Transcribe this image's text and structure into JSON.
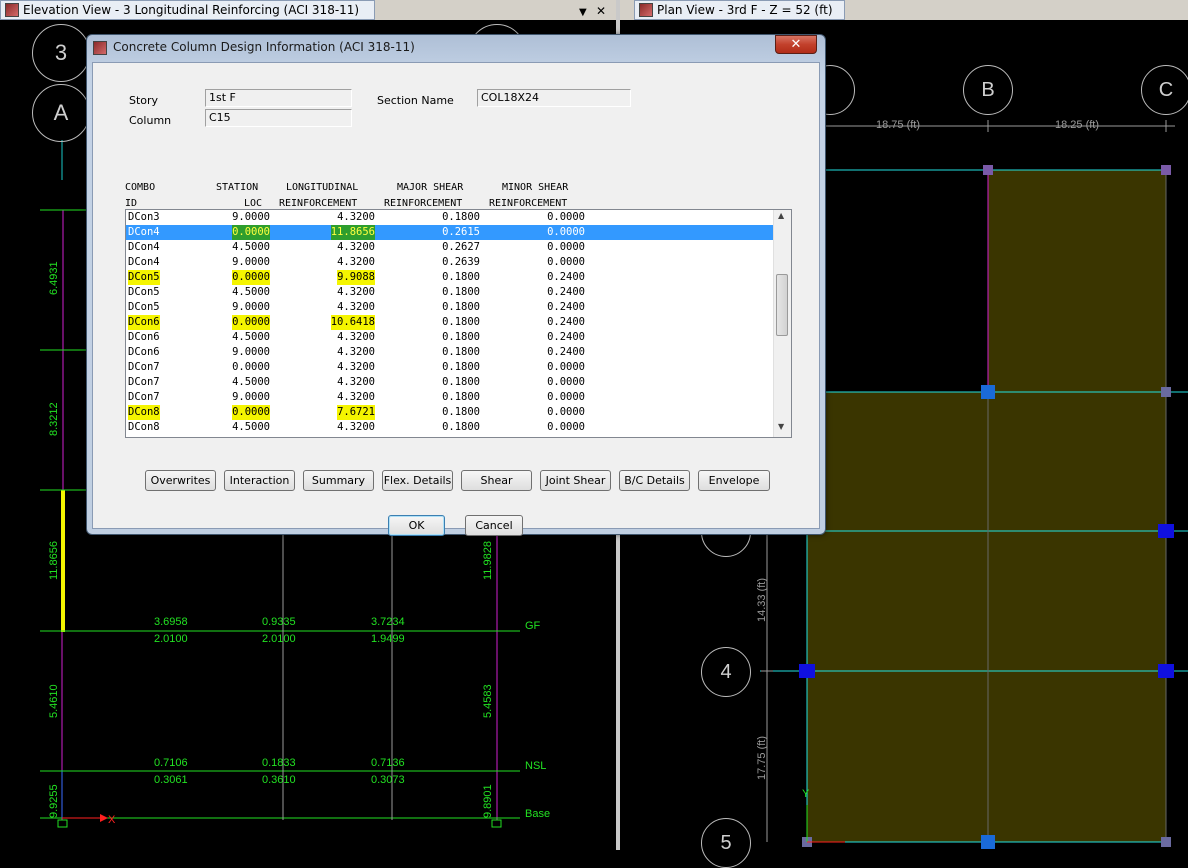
{
  "left_view": {
    "title": "Elevation View - 3  Longitudinal Reinforcing  (ACI 318-11)",
    "dropdown_glyph": "▼",
    "close_glyph": "✕",
    "bubbles": [
      "3",
      "A"
    ],
    "column_values": [
      "6.4931",
      "8.3212",
      "11.8656",
      "5.4610",
      "9.9255"
    ],
    "right_column_values": [
      "11.9828",
      "5.4583",
      "9.8901"
    ],
    "beam_top_values": [
      "3.6958",
      "0.9335",
      "3.7234",
      "0.7106",
      "0.1833",
      "0.7136"
    ],
    "beam_bottom_values": [
      "2.0100",
      "2.0100",
      "1.9499",
      "0.3061",
      "0.3610",
      "0.3073"
    ],
    "level_labels": [
      "GF",
      "NSL",
      "Base"
    ],
    "axis_x": "X"
  },
  "right_view": {
    "title": "Plan View - 3rd F - Z = 52 (ft)",
    "bubbles": [
      "B",
      "C",
      "4",
      "5"
    ],
    "dims": [
      "18.75 (ft)",
      "18.25 (ft)",
      "14.33 (ft)",
      "17.75 (ft)"
    ],
    "axis_y": "Y"
  },
  "dialog": {
    "title": "Concrete Column Design Information (ACI 318-11)",
    "close": "✕",
    "story_label": "Story",
    "story_value": "1st F",
    "column_label": "Column",
    "column_value": "C15",
    "section_label": "Section Name",
    "section_value": "COL18X24",
    "headers": {
      "h1": [
        "COMBO",
        "STATION",
        "LONGITUDINAL",
        "MAJOR SHEAR",
        "MINOR SHEAR"
      ],
      "h2": [
        "ID",
        "LOC",
        "REINFORCEMENT",
        "REINFORCEMENT",
        "REINFORCEMENT"
      ]
    },
    "rows": [
      {
        "id": "DCon3",
        "loc": "9.0000",
        "long": "4.3200",
        "major": "0.1800",
        "minor": "0.0000",
        "state": ""
      },
      {
        "id": "DCon4",
        "loc": "0.0000",
        "long": "11.8656",
        "major": "0.2615",
        "minor": "0.0000",
        "state": "selected"
      },
      {
        "id": "DCon4",
        "loc": "4.5000",
        "long": "4.3200",
        "major": "0.2627",
        "minor": "0.0000",
        "state": ""
      },
      {
        "id": "DCon4",
        "loc": "9.0000",
        "long": "4.3200",
        "major": "0.2639",
        "minor": "0.0000",
        "state": ""
      },
      {
        "id": "DCon5",
        "loc": "0.0000",
        "long": "9.9088",
        "major": "0.1800",
        "minor": "0.2400",
        "state": "highlight"
      },
      {
        "id": "DCon5",
        "loc": "4.5000",
        "long": "4.3200",
        "major": "0.1800",
        "minor": "0.2400",
        "state": ""
      },
      {
        "id": "DCon5",
        "loc": "9.0000",
        "long": "4.3200",
        "major": "0.1800",
        "minor": "0.2400",
        "state": ""
      },
      {
        "id": "DCon6",
        "loc": "0.0000",
        "long": "10.6418",
        "major": "0.1800",
        "minor": "0.2400",
        "state": "highlight"
      },
      {
        "id": "DCon6",
        "loc": "4.5000",
        "long": "4.3200",
        "major": "0.1800",
        "minor": "0.2400",
        "state": ""
      },
      {
        "id": "DCon6",
        "loc": "9.0000",
        "long": "4.3200",
        "major": "0.1800",
        "minor": "0.2400",
        "state": ""
      },
      {
        "id": "DCon7",
        "loc": "0.0000",
        "long": "4.3200",
        "major": "0.1800",
        "minor": "0.0000",
        "state": ""
      },
      {
        "id": "DCon7",
        "loc": "4.5000",
        "long": "4.3200",
        "major": "0.1800",
        "minor": "0.0000",
        "state": ""
      },
      {
        "id": "DCon7",
        "loc": "9.0000",
        "long": "4.3200",
        "major": "0.1800",
        "minor": "0.0000",
        "state": ""
      },
      {
        "id": "DCon8",
        "loc": "0.0000",
        "long": "7.6721",
        "major": "0.1800",
        "minor": "0.0000",
        "state": "highlight"
      },
      {
        "id": "DCon8",
        "loc": "4.5000",
        "long": "4.3200",
        "major": "0.1800",
        "minor": "0.0000",
        "state": ""
      }
    ],
    "buttons": [
      "Overwrites",
      "Interaction",
      "Summary",
      "Flex. Details",
      "Shear",
      "Joint Shear",
      "B/C Details",
      "Envelope"
    ],
    "ok": "OK",
    "cancel": "Cancel",
    "scroll_up": "▲",
    "scroll_down": "▼"
  },
  "colors": {
    "cad_green": "#22e122",
    "highlight": "#f5f500",
    "selection": "#3399ff"
  }
}
